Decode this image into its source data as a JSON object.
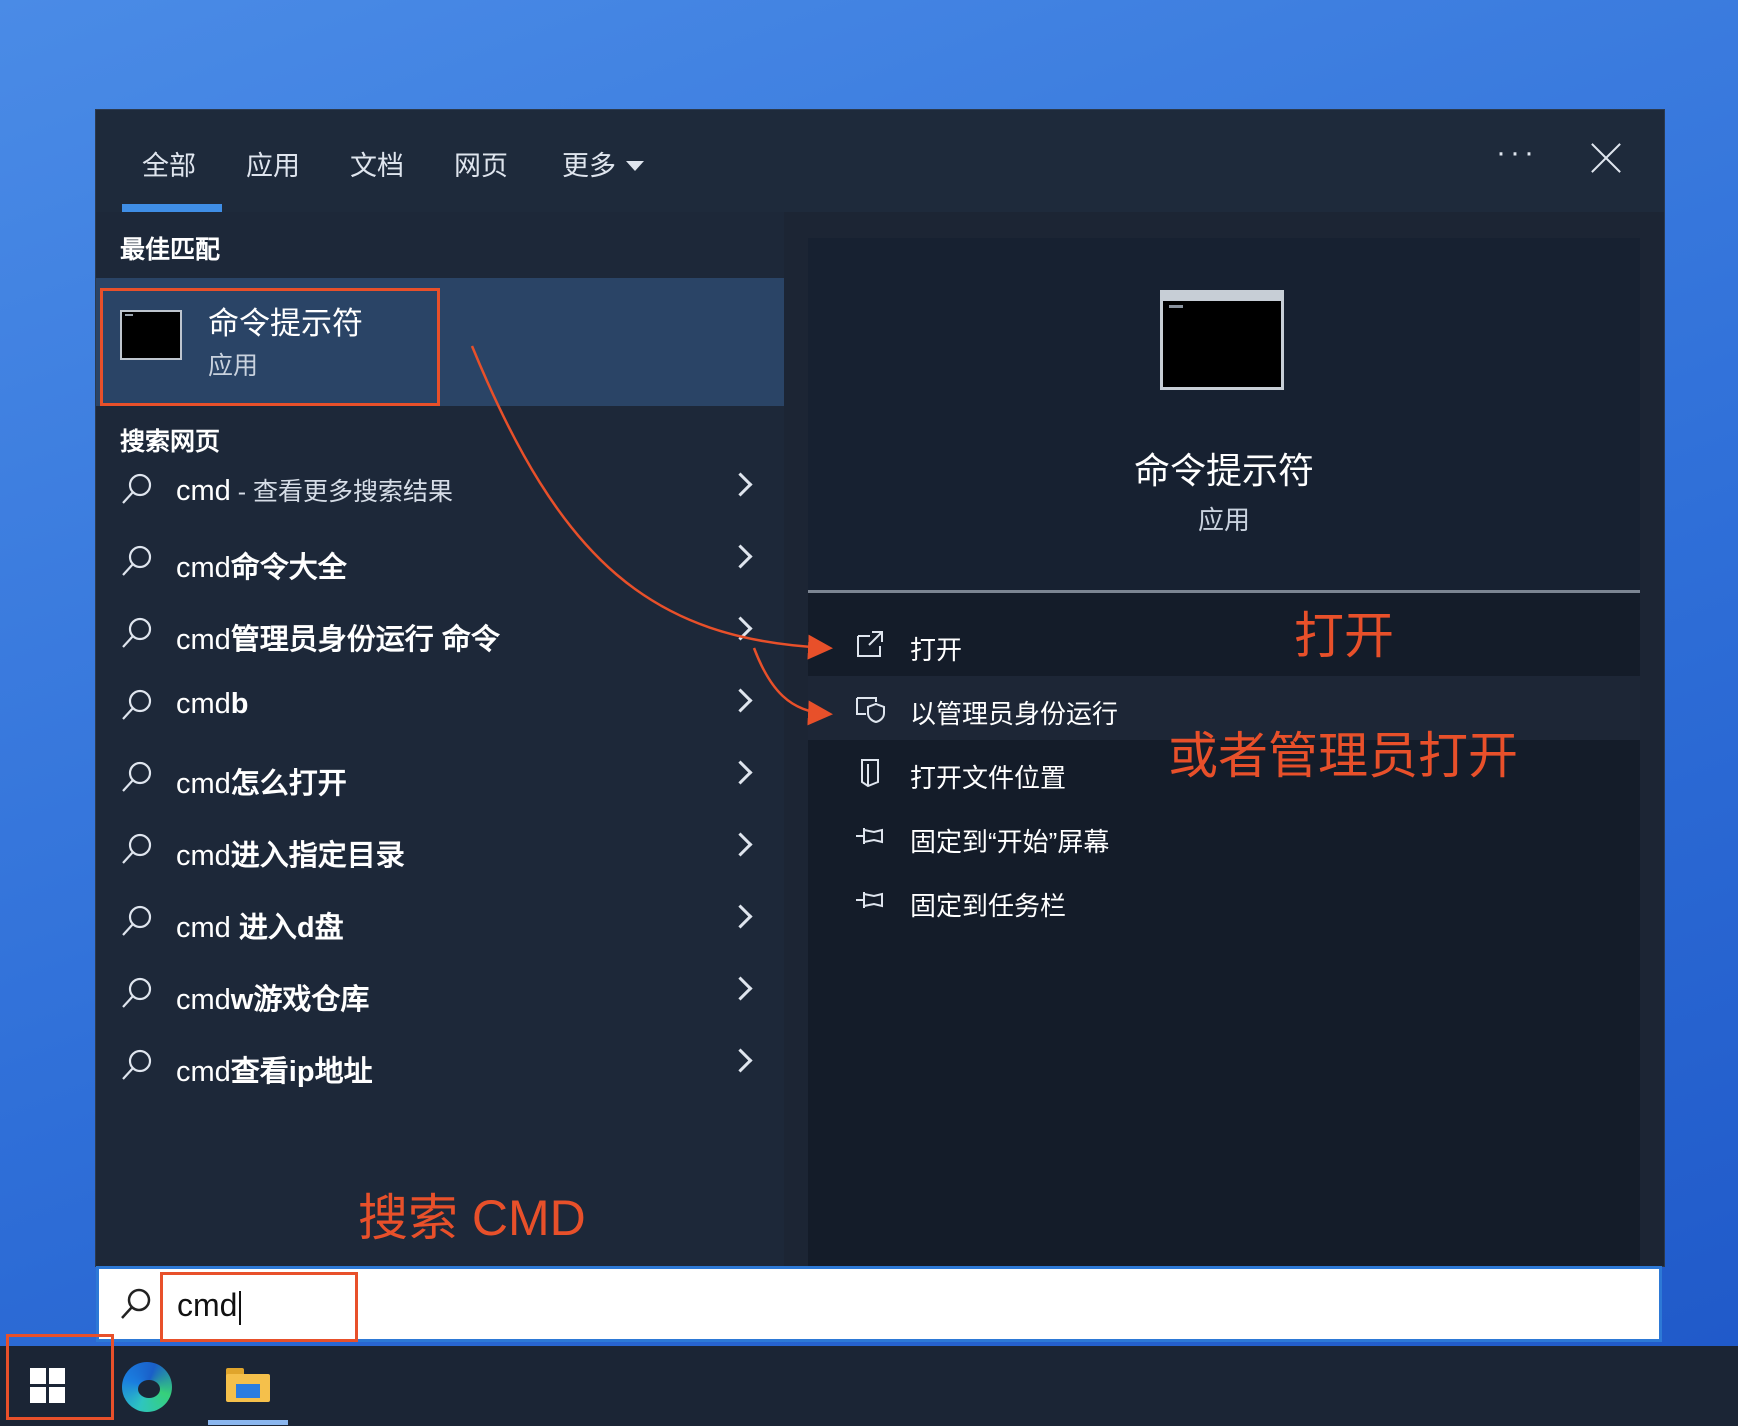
{
  "tabs": [
    {
      "label": "全部"
    },
    {
      "label": "应用"
    },
    {
      "label": "文档"
    },
    {
      "label": "网页"
    },
    {
      "label": "更多"
    }
  ],
  "more_options": "···",
  "best_match": {
    "section_label": "最佳匹配",
    "title": "命令提示符",
    "subtitle": "应用"
  },
  "web_search": {
    "section_label": "搜索网页",
    "results": [
      {
        "query": "cmd",
        "suffix": "",
        "detail": " - 查看更多搜索结果"
      },
      {
        "query": "cmd",
        "suffix": "命令大全",
        "detail": ""
      },
      {
        "query": "cmd",
        "suffix": "管理员身份运行 命令",
        "detail": ""
      },
      {
        "query": "cmd",
        "suffix": "b",
        "detail": ""
      },
      {
        "query": "cmd",
        "suffix": "怎么打开",
        "detail": ""
      },
      {
        "query": "cmd",
        "suffix": "进入指定目录",
        "detail": ""
      },
      {
        "query": "cmd",
        "suffix": " 进入d盘",
        "detail": ""
      },
      {
        "query": "cmd",
        "suffix": "w游戏仓库",
        "detail": ""
      },
      {
        "query": "cmd",
        "suffix": "查看ip地址",
        "detail": ""
      }
    ]
  },
  "preview": {
    "title": "命令提示符",
    "subtitle": "应用",
    "actions": [
      {
        "label": "打开",
        "icon": "open-icon"
      },
      {
        "label": "以管理员身份运行",
        "icon": "shield-icon"
      },
      {
        "label": "打开文件位置",
        "icon": "file-location-icon"
      },
      {
        "label": "固定到“开始”屏幕",
        "icon": "pin-icon"
      },
      {
        "label": "固定到任务栏",
        "icon": "pin-icon"
      }
    ]
  },
  "search_box": {
    "value": "cmd"
  },
  "annotations": {
    "open": "打开",
    "admin_open": "或者管理员打开",
    "search_cmd": "搜索 CMD"
  },
  "colors": {
    "annotation": "#e8502a",
    "accent": "#3f8ee6"
  }
}
